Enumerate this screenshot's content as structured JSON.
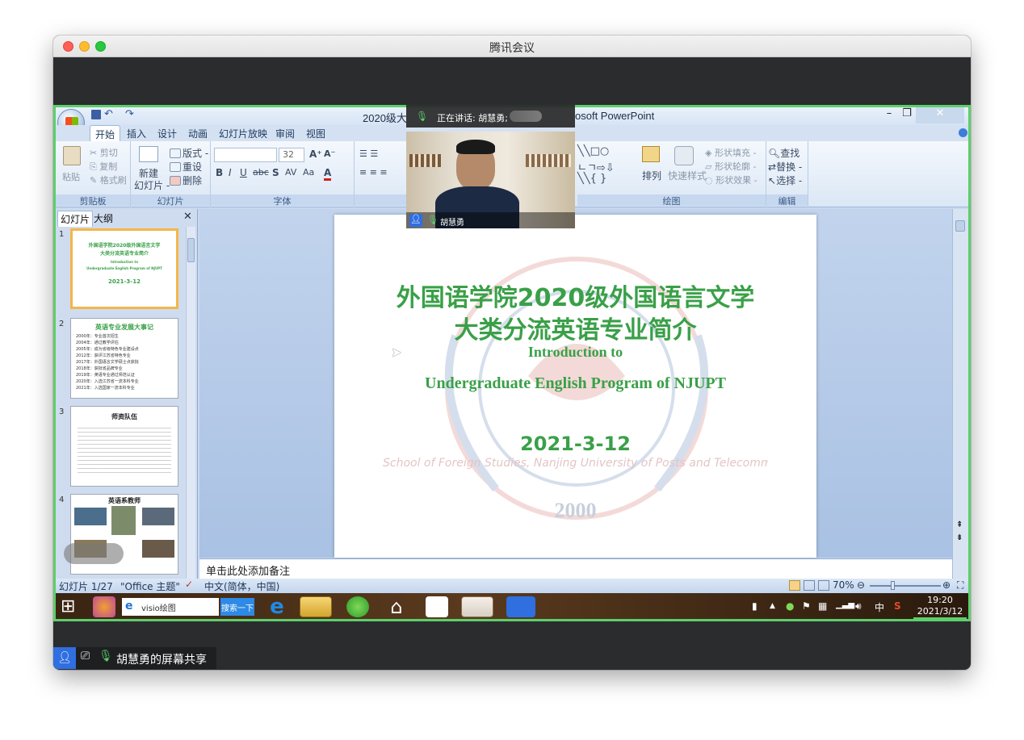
{
  "window": {
    "title": "腾讯会议"
  },
  "meeting": {
    "speaking_label": "正在讲话: 胡慧勇;",
    "participant_name": "胡慧勇",
    "share_label": "胡慧勇的屏幕共享"
  },
  "ppt": {
    "title_left": "2020级大",
    "title_right": "osoft PowerPoint",
    "tabs": [
      "开始",
      "插入",
      "设计",
      "动画",
      "幻灯片放映",
      "审阅",
      "视图"
    ],
    "clipboard": {
      "paste": "粘贴",
      "cut": "剪切",
      "copy": "复制",
      "format_painter": "格式刷",
      "label": "剪贴板"
    },
    "slides_group": {
      "new_slide": "新建",
      "new_slide_2": "幻灯片 -",
      "layout": "版式 -",
      "reset": "重设",
      "delete": "删除",
      "label": "幻灯片"
    },
    "font_group": {
      "size": "32",
      "label": "字体"
    },
    "drawing_group": {
      "arrange": "排列",
      "quick_styles": "快速样式",
      "fill": "形状填充 -",
      "outline": "形状轮廓 -",
      "effects": "形状效果 -",
      "label": "绘图"
    },
    "editing_group": {
      "find": "查找",
      "replace": "替换 -",
      "select": "选择 -",
      "label": "编辑"
    },
    "pane_tabs": [
      "幻灯片",
      "大纲"
    ],
    "thumbnails": [
      {
        "num": "1",
        "title_line1": "外国语学院2020级外国语言文学",
        "title_line2": "大类分流英语专业简介",
        "sub1": "Introduction to",
        "sub2": "Undergraduate English Program of NJUPT",
        "date": "2021-3-12"
      },
      {
        "num": "2",
        "title": "英语专业发展大事记",
        "lines": [
          "2000年：专业首次招生",
          "2004年：通过教学评估",
          "2005年：成为省级特色专业建设点",
          "2012年：获评江苏省特色专业",
          "2017年：外国语言文学硕士点获批",
          "2018年：获批省品牌专业",
          "2019年：英语专业通过师范认证",
          "2020年：入选江苏省一流本科专业",
          "2021年：入选国家一流本科专业"
        ]
      },
      {
        "num": "3",
        "title": "师资队伍"
      },
      {
        "num": "4",
        "title": "英语系教师"
      }
    ],
    "slide": {
      "title_line1": "外国语学院2020级外国语言文学",
      "title_line2": "大类分流英语专业简介",
      "subtitle_line1": "Introduction to",
      "subtitle_line2": "Undergraduate English Program of NJUPT",
      "date": "2021-3-12",
      "watermark_year": "2000",
      "watermark_arc_left": "School of Foreign Studies, Nanjing University of Posts and Telecommunications"
    },
    "notes_placeholder": "单击此处添加备注",
    "status": {
      "slide_info": "幻灯片 1/27",
      "theme": "\"Office 主题\"",
      "language": "中文(简体，中国)",
      "zoom": "70%"
    }
  },
  "taskbar": {
    "search_text": "visio绘图",
    "search_button": "搜索一下",
    "ime": "中",
    "time": "19:20",
    "date": "2021/3/12"
  },
  "colors": {
    "accent_green": "#5ccf6a",
    "slide_title_green": "#3aa048"
  }
}
